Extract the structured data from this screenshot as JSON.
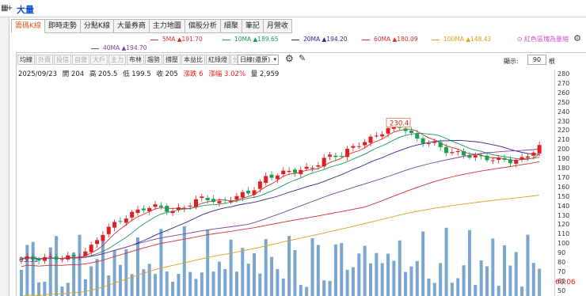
{
  "window": {
    "title": "大量"
  },
  "topbar": {
    "icons": [
      "grid-icon",
      "plus-icon"
    ]
  },
  "tabs": [
    {
      "label": "籌碼K線",
      "active": true
    },
    {
      "label": "即時走勢",
      "active": false
    },
    {
      "label": "分點K線",
      "active": false
    },
    {
      "label": "大量券商",
      "active": false
    },
    {
      "label": "主力地圖",
      "active": false
    },
    {
      "label": "個股分析",
      "active": false
    },
    {
      "label": "細聚",
      "active": false
    },
    {
      "label": "筆記",
      "active": false
    },
    {
      "label": "月營收",
      "active": false
    }
  ],
  "ma_legend": [
    {
      "label": "5MA ▲191.70",
      "color": "#d43030"
    },
    {
      "label": "10MA ▲189.65",
      "color": "#1a9a5a"
    },
    {
      "label": "20MA ▲194.20",
      "color": "#2a2a90"
    },
    {
      "label": "60MA ▲180.09",
      "color": "#d43030"
    },
    {
      "label": "100MA ▲148.43",
      "color": "#e0a020"
    },
    {
      "label": "40MA ▲194.70",
      "color": "#8040a0"
    }
  ],
  "right_note": "⊙ 紅色區塊為量縮",
  "chart_toolbar": {
    "buttons": [
      {
        "label": "均線",
        "dim": false
      },
      {
        "label": "外資",
        "dim": true
      },
      {
        "label": "投信",
        "dim": true
      },
      {
        "label": "自營",
        "dim": true
      },
      {
        "label": "大戶",
        "dim": true
      },
      {
        "label": "主力",
        "dim": true
      },
      {
        "label": "布林",
        "dim": false
      },
      {
        "label": "趨勢",
        "dim": false
      },
      {
        "label": "撐壓",
        "dim": false
      },
      {
        "label": "本益比",
        "dim": false
      },
      {
        "label": "紅綠燈",
        "dim": false
      },
      {
        "label": "分價量",
        "dim": true
      }
    ],
    "period": "日線(還原)",
    "display_label": "顯示:",
    "display_value": "90",
    "display_unit": "根"
  },
  "info": {
    "date": "2025/09/23",
    "open": "開 204",
    "high": "高 205.5",
    "low": "低 199.5",
    "close": "收 205",
    "change": "漲跌 6",
    "pct": "漲幅 3.02%",
    "volume": "量 2,959"
  },
  "price_axis": [
    "280",
    "270",
    "260",
    "250",
    "240",
    "230",
    "220",
    "210",
    "200",
    "190",
    "180",
    "170",
    "160",
    "150",
    "140",
    "130",
    "120",
    "110",
    "100",
    "90",
    "80",
    "70",
    "60",
    "50"
  ],
  "price_marker": "60.06",
  "chart_labels": {
    "peak": "230.4",
    "low": "83.31"
  },
  "colors": {
    "up": "#e02020",
    "down": "#18a050",
    "accent": "#1050c8",
    "volume": "#7aa6cf"
  },
  "chart_data": {
    "type": "candlestick",
    "y_axis_ticks": [
      280,
      270,
      260,
      250,
      240,
      230,
      220,
      210,
      200,
      190,
      180,
      170,
      160,
      150,
      140,
      130,
      120,
      110,
      100,
      90,
      80,
      70,
      60,
      50
    ],
    "close_last": 205,
    "high_annotation": 230.4,
    "low_annotation": 83.31,
    "series": [
      {
        "name": "5MA",
        "value": 191.7
      },
      {
        "name": "10MA",
        "value": 189.65
      },
      {
        "name": "20MA",
        "value": 194.2
      },
      {
        "name": "40MA",
        "value": 194.7
      },
      {
        "name": "60MA",
        "value": 180.09
      },
      {
        "name": "100MA",
        "value": 148.43
      }
    ]
  }
}
